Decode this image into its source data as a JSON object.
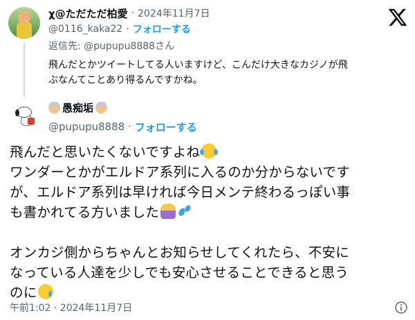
{
  "parent_tweet": {
    "display_name": "χ@ただただ柏愛",
    "separator": "·",
    "date": "2024年11月7日",
    "handle": "@0116_kaka22",
    "dot": "·",
    "follow_label": "フォローする",
    "replying_to": "返信先: @pupupu8888さん",
    "text_line1": "飛んだとかツイートしてる人いますけど、こんだけ大きなカジノが飛",
    "text_line2": "ぶなんてことあり得るんですかね。"
  },
  "main_tweet": {
    "display_name": "愚痴垢",
    "handle": "@pupupu8888",
    "dot": "·",
    "follow_label": "フォローする",
    "lines": [
      "飛んだと思いたくないですよね",
      "ワンダーとかがエルドア系列に入るのか分からないです",
      "が、エルドア系列は早ければ今日メンテ終わるっぽい事",
      "も書かれてる方いました",
      "",
      "オンカジ側からちゃんとお知らせしてくれたら、不安に",
      "なっている人達を少しでも安心させることできると思う",
      "のに"
    ],
    "timestamp": "午前1:02 · 2024年11月7日"
  },
  "icons": {
    "platform_logo": "x-logo-icon",
    "info": "info-icon",
    "emoji_joy": "tears-of-joy-emoji",
    "emoji_bow": "person-bowing-emoji",
    "emoji_sweat": "sweat-droplets-emoji",
    "emoji_cry": "crying-face-emoji",
    "name_emoji": "older-person-emoji"
  },
  "colors": {
    "text_primary": "#0f1419",
    "text_secondary": "#536471",
    "link_blue": "#1d9bf0",
    "thread_line": "#cfd9de"
  }
}
